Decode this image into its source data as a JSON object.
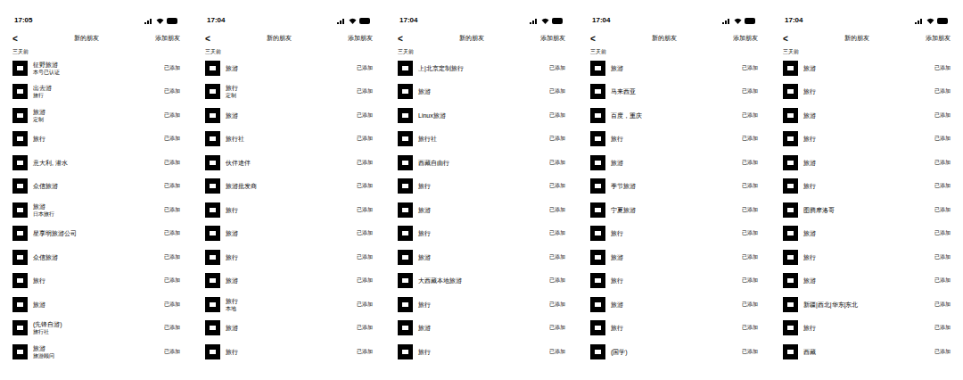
{
  "screens": [
    {
      "time": "17:05",
      "back": "<",
      "title": "新的朋友",
      "action": "添加朋友",
      "section": "三天前",
      "rows": [
        {
          "name": "征野旅游",
          "sub": "本号已认证",
          "status": "已添加"
        },
        {
          "name": "出去游",
          "sub": "旅行",
          "status": "已添加"
        },
        {
          "name": "旅游",
          "sub": "定制",
          "status": "已添加"
        },
        {
          "name": "旅行",
          "sub": "",
          "status": "已添加"
        },
        {
          "name": "意大利, 潜水",
          "sub": "",
          "status": "已添加"
        },
        {
          "name": "众信旅游",
          "sub": "",
          "status": "已添加"
        },
        {
          "name": "旅游",
          "sub": "日本旅行",
          "status": "已添加"
        },
        {
          "name": "星享明旅游公司",
          "sub": "",
          "status": "已添加"
        },
        {
          "name": "众信旅游",
          "sub": "",
          "status": "已添加"
        },
        {
          "name": "旅行",
          "sub": "",
          "status": "已添加"
        },
        {
          "name": "旅游",
          "sub": "",
          "status": "已添加"
        },
        {
          "name": "(先锋自游)",
          "sub": "旅行社",
          "status": "已添加"
        },
        {
          "name": "旅游",
          "sub": "旅游顾问",
          "status": "已添加"
        }
      ]
    },
    {
      "time": "17:04",
      "back": "<",
      "title": "新的朋友",
      "action": "添加朋友",
      "section": "三天前",
      "rows": [
        {
          "name": "旅游",
          "sub": "",
          "status": "已添加"
        },
        {
          "name": "旅行",
          "sub": "定制",
          "status": "已添加"
        },
        {
          "name": "旅游",
          "sub": "",
          "status": "已添加"
        },
        {
          "name": "旅行社",
          "sub": "",
          "status": "已添加"
        },
        {
          "name": "伙伴途伴",
          "sub": "",
          "status": "已添加"
        },
        {
          "name": "旅游批发商",
          "sub": "",
          "status": "已添加"
        },
        {
          "name": "旅行",
          "sub": "",
          "status": "已添加"
        },
        {
          "name": "旅游",
          "sub": "",
          "status": "已添加"
        },
        {
          "name": "旅行",
          "sub": "",
          "status": "已添加"
        },
        {
          "name": "旅游",
          "sub": "",
          "status": "已添加"
        },
        {
          "name": "旅行",
          "sub": "本地",
          "status": "已添加"
        },
        {
          "name": "旅游",
          "sub": "",
          "status": "已添加"
        },
        {
          "name": "旅行",
          "sub": "",
          "status": "已添加"
        }
      ]
    },
    {
      "time": "17:04",
      "back": "<",
      "title": "新的朋友",
      "action": "添加朋友",
      "section": "三天前",
      "rows": [
        {
          "name": "上|北京定制旅行",
          "sub": "",
          "status": "已添加"
        },
        {
          "name": "旅游",
          "sub": "",
          "status": "已添加"
        },
        {
          "name": "Linux旅游",
          "sub": "",
          "status": "已添加"
        },
        {
          "name": "旅行社",
          "sub": "",
          "status": "已添加"
        },
        {
          "name": "西藏自由行",
          "sub": "",
          "status": "已添加"
        },
        {
          "name": "旅行",
          "sub": "",
          "status": "已添加"
        },
        {
          "name": "旅游",
          "sub": "",
          "status": "已添加"
        },
        {
          "name": "旅行",
          "sub": "",
          "status": "已添加"
        },
        {
          "name": "旅游",
          "sub": "",
          "status": "已添加"
        },
        {
          "name": "大西藏本地旅游",
          "sub": "",
          "status": "已添加"
        },
        {
          "name": "旅行",
          "sub": "",
          "status": "已添加"
        },
        {
          "name": "旅游",
          "sub": "",
          "status": "已添加"
        },
        {
          "name": "旅行",
          "sub": "",
          "status": "已添加"
        }
      ]
    },
    {
      "time": "17:04",
      "back": "<",
      "title": "新的朋友",
      "action": "添加朋友",
      "section": "三天前",
      "rows": [
        {
          "name": "旅游",
          "sub": "",
          "status": "已添加"
        },
        {
          "name": "马来西亚",
          "sub": "",
          "status": "已添加"
        },
        {
          "name": "百度，重庆",
          "sub": "",
          "status": "已添加"
        },
        {
          "name": "旅行",
          "sub": "",
          "status": "已添加"
        },
        {
          "name": "旅游",
          "sub": "",
          "status": "已添加"
        },
        {
          "name": "季节旅游",
          "sub": "",
          "status": "已添加"
        },
        {
          "name": "宁夏旅游",
          "sub": "",
          "status": "已添加"
        },
        {
          "name": "旅行",
          "sub": "",
          "status": "已添加"
        },
        {
          "name": "旅游",
          "sub": "",
          "status": "已添加"
        },
        {
          "name": "旅行",
          "sub": "",
          "status": "已添加"
        },
        {
          "name": "旅游",
          "sub": "",
          "status": "已添加"
        },
        {
          "name": "旅行",
          "sub": "",
          "status": "已添加"
        },
        {
          "name": "(国学)",
          "sub": "",
          "status": "已添加"
        }
      ]
    },
    {
      "time": "17:04",
      "back": "<",
      "title": "新的朋友",
      "action": "添加朋友",
      "section": "三天前",
      "rows": [
        {
          "name": "旅游",
          "sub": "",
          "status": "已添加"
        },
        {
          "name": "旅行",
          "sub": "",
          "status": "已添加"
        },
        {
          "name": "旅游",
          "sub": "",
          "status": "已添加"
        },
        {
          "name": "旅行",
          "sub": "",
          "status": "已添加"
        },
        {
          "name": "旅游",
          "sub": "",
          "status": "已添加"
        },
        {
          "name": "旅行",
          "sub": "",
          "status": "已添加"
        },
        {
          "name": "图腾摩洛哥",
          "sub": "",
          "status": "已添加"
        },
        {
          "name": "旅游",
          "sub": "",
          "status": "已添加"
        },
        {
          "name": "旅行",
          "sub": "",
          "status": "已添加"
        },
        {
          "name": "旅游",
          "sub": "",
          "status": "已添加"
        },
        {
          "name": "新疆|西北|华东|东北",
          "sub": "",
          "status": "已添加"
        },
        {
          "name": "旅行",
          "sub": "",
          "status": "已添加"
        },
        {
          "name": "西藏",
          "sub": "",
          "status": "已添加"
        }
      ]
    }
  ]
}
